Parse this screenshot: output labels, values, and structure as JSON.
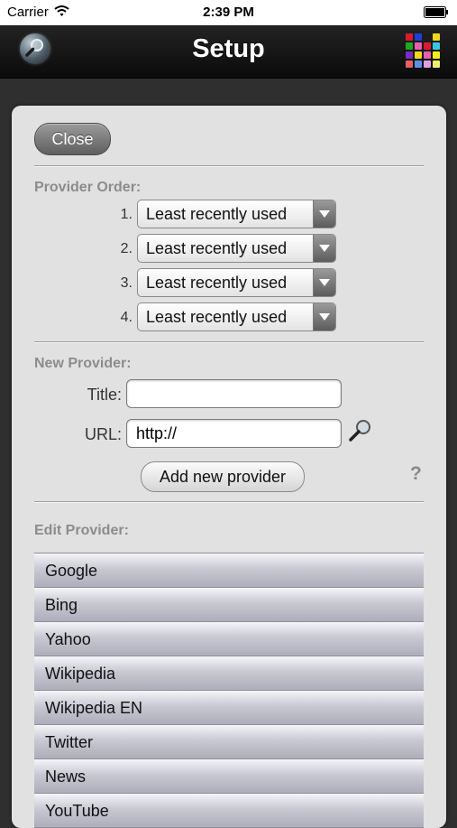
{
  "status_bar": {
    "carrier": "Carrier",
    "time": "2:39 PM"
  },
  "nav_bar": {
    "title": "Setup",
    "left_icon": "globe-magnifier-icon",
    "right_icon": "color-grid-icon",
    "grid_colors": [
      "#d81c2e",
      "#1f3fd8",
      "#1d1d1d",
      "#f0d81c",
      "#1da91d",
      "#e85fb0",
      "#d81c2e",
      "#34c8e8",
      "#7b2cc8",
      "#f0d81c",
      "#e85fb0",
      "#f0f01c",
      "#e85f5f",
      "#5f8fe8",
      "#d8a0e8",
      "#f0f06a"
    ]
  },
  "panel": {
    "close_label": "Close",
    "provider_order": {
      "label": "Provider Order:",
      "rows": [
        {
          "number": "1.",
          "value": "Least recently used"
        },
        {
          "number": "2.",
          "value": "Least recently used"
        },
        {
          "number": "3.",
          "value": "Least recently used"
        },
        {
          "number": "4.",
          "value": "Least recently used"
        }
      ]
    },
    "new_provider": {
      "label": "New Provider:",
      "title_label": "Title:",
      "title_value": "",
      "url_label": "URL:",
      "url_value": "http://",
      "add_label": "Add new provider",
      "help_label": "?"
    },
    "edit_provider": {
      "label": "Edit Provider:",
      "items": [
        "Google",
        "Bing",
        "Yahoo",
        "Wikipedia",
        "Wikipedia EN",
        "Twitter",
        "News",
        "YouTube"
      ]
    }
  }
}
